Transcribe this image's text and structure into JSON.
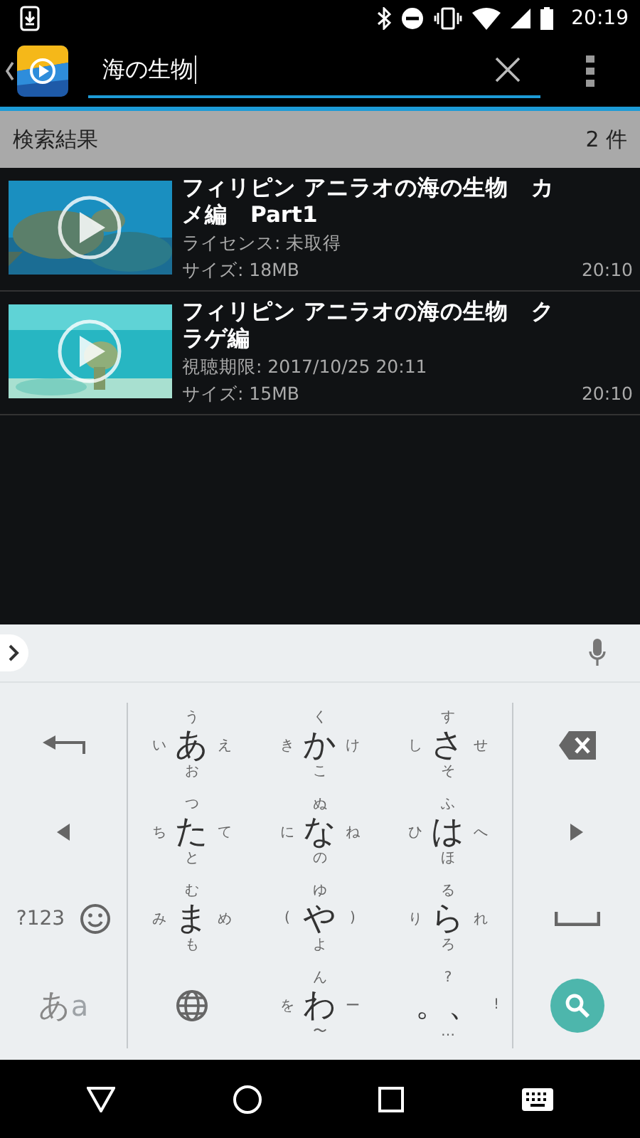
{
  "status_bar": {
    "time": "20:19"
  },
  "search": {
    "value": "海の生物"
  },
  "results_header": {
    "title": "検索結果",
    "count": "2 件"
  },
  "videos": [
    {
      "title": "フィリピン アニラオの海の生物　カメ編　Part1",
      "detail": "ライセンス: 未取得",
      "size": "サイズ: 18MB",
      "time": "20:10"
    },
    {
      "title": "フィリピン アニラオの海の生物　クラゲ編",
      "detail": "視聴期限: 2017/10/25 20:11",
      "size": "サイズ: 15MB",
      "time": "20:10"
    }
  ],
  "keyboard": {
    "rows": [
      {
        "keys": [
          {
            "kind": "enter"
          },
          {
            "kind": "flick",
            "main": "あ",
            "up": "う",
            "left": "い",
            "right": "え",
            "down": "お"
          },
          {
            "kind": "flick",
            "main": "か",
            "up": "く",
            "left": "き",
            "right": "け",
            "down": "こ"
          },
          {
            "kind": "flick",
            "main": "さ",
            "up": "す",
            "left": "し",
            "right": "せ",
            "down": "そ"
          },
          {
            "kind": "backspace"
          }
        ]
      },
      {
        "keys": [
          {
            "kind": "left"
          },
          {
            "kind": "flick",
            "main": "た",
            "up": "つ",
            "left": "ち",
            "right": "て",
            "down": "と"
          },
          {
            "kind": "flick",
            "main": "な",
            "up": "ぬ",
            "left": "に",
            "right": "ね",
            "down": "の"
          },
          {
            "kind": "flick",
            "main": "は",
            "up": "ふ",
            "left": "ひ",
            "right": "へ",
            "down": "ほ"
          },
          {
            "kind": "right"
          }
        ]
      },
      {
        "keys": [
          {
            "kind": "symbols",
            "label": "?123"
          },
          {
            "kind": "flick",
            "main": "ま",
            "up": "む",
            "left": "み",
            "right": "め",
            "down": "も"
          },
          {
            "kind": "flick",
            "main": "や",
            "up": "ゆ",
            "left": "(",
            "right": ")",
            "down": "よ"
          },
          {
            "kind": "flick",
            "main": "ら",
            "up": "る",
            "left": "り",
            "right": "れ",
            "down": "ろ"
          },
          {
            "kind": "space"
          }
        ]
      },
      {
        "keys": [
          {
            "kind": "mode",
            "label": "あ",
            "alt": "a"
          },
          {
            "kind": "globe"
          },
          {
            "kind": "flick",
            "main": "わ",
            "up": "ん",
            "left": "を",
            "right": "ー",
            "down": "〜"
          },
          {
            "kind": "flick",
            "main": "。、",
            "up": "?",
            "right": "!",
            "down": "…"
          },
          {
            "kind": "search"
          }
        ]
      }
    ]
  }
}
